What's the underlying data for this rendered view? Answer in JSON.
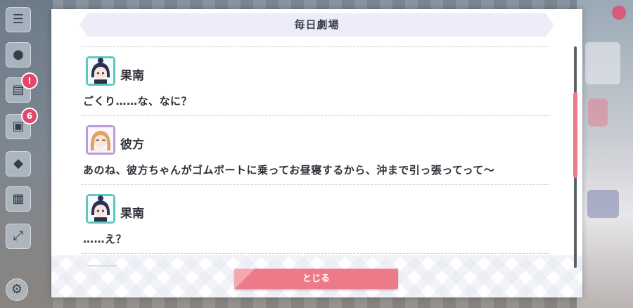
{
  "dialog": {
    "title": "毎日劇場",
    "close_label": "とじる"
  },
  "entries": [
    {
      "speaker": "果南",
      "text": "ごくり……な、なに？",
      "avatar": "kanan-avatar"
    },
    {
      "speaker": "彼方",
      "text": "あのね、彼方ちゃんがゴムボートに乗ってお昼寝するから、沖まで引っ張ってって〜",
      "avatar": "kanata-avatar"
    },
    {
      "speaker": "果南",
      "text": "……え？",
      "avatar": "kanan-avatar"
    }
  ],
  "background": {
    "side_badge_1": "!",
    "side_badge_2": "6"
  },
  "colors": {
    "accent": "#ee7a89",
    "scroll_thumb": "#ef7a8a",
    "title_bar": "#ecedf8",
    "text": "#2e3038"
  }
}
